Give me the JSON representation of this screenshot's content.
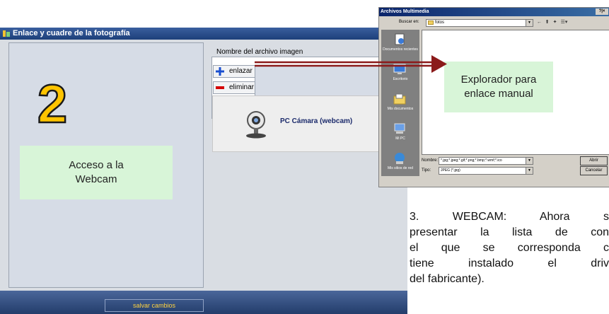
{
  "window": {
    "title": "Enlace y cuadre de la fotografía",
    "file_label": "Nombre del archivo imagen",
    "link_button": "enlazar",
    "delete_button": "eliminar",
    "camera_button": "PC Cámara (webcam)",
    "save_button": "salvar cambios"
  },
  "annotations": {
    "step_number": "2",
    "webcam_callout": [
      "Acceso a la",
      "Webcam"
    ],
    "explorer_callout": [
      "Explorador para",
      "enlace manual"
    ],
    "description_lines": [
      "3. WEBCAM: Ahora s",
      "presentar la lista de con",
      "el que se corresponda c",
      "tiene instalado el driv",
      "del fabricante)."
    ]
  },
  "dialog": {
    "title": "Archivos Multimedia",
    "controls": "?|×",
    "look_in_label": "Buscar en:",
    "look_in_value": "fotos",
    "places": [
      "Documentos recientes",
      "Escritorio",
      "Mis documentos",
      "Mi PC",
      "Mis sitios de red"
    ],
    "filename_label": "Nombre:",
    "filename_value": "*.jpg;*.jpeg;*.gif;*.png;*.bmp;*.wmf;*.ico",
    "filetype_label": "Tipo:",
    "filetype_value": "JPEG (*.jpg)",
    "open_button": "Abrir",
    "cancel_button": "Cancelar"
  },
  "colors": {
    "callout_bg": "#d8f5d8",
    "arrow": "#8b1a1a",
    "badge_fill": "#ffc400",
    "title_bar": "#1d3f7a"
  }
}
